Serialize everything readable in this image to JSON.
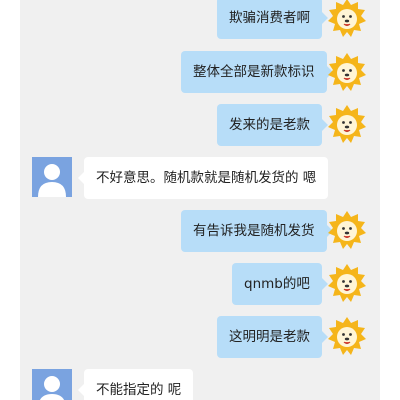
{
  "colors": {
    "chat_background": "#f0f0f0",
    "outgoing_bubble": "#b7ddf8",
    "incoming_bubble": "#ffffff",
    "lion_yellow": "#f5b51a",
    "user_avatar": "#7aa3e0"
  },
  "messages": [
    {
      "side": "right",
      "text": "欺骗消费者啊",
      "avatar_icon": "lion-avatar-icon"
    },
    {
      "side": "right",
      "text": "整体全部是新款标识",
      "avatar_icon": "lion-avatar-icon"
    },
    {
      "side": "right",
      "text": "发来的是老款",
      "avatar_icon": "lion-avatar-icon"
    },
    {
      "side": "left",
      "text": "不好意思。随机款就是随机发货的 嗯",
      "avatar_icon": "user-avatar-icon"
    },
    {
      "side": "right",
      "text": "有告诉我是随机发货",
      "avatar_icon": "lion-avatar-icon"
    },
    {
      "side": "right",
      "text": "qnmb的吧",
      "avatar_icon": "lion-avatar-icon"
    },
    {
      "side": "right",
      "text": "这明明是老款",
      "avatar_icon": "lion-avatar-icon"
    },
    {
      "side": "left",
      "text": "不能指定的 呢",
      "avatar_icon": "user-avatar-icon"
    }
  ]
}
